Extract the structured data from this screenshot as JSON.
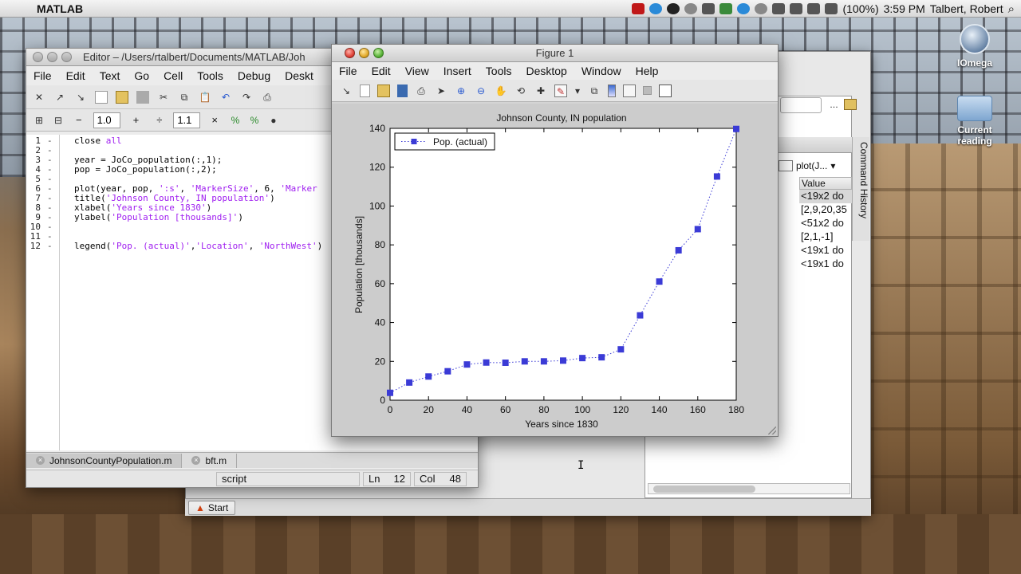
{
  "menubar": {
    "app": "MATLAB",
    "battery": "(100%)",
    "clock": "3:59 PM",
    "user": "Talbert, Robert"
  },
  "desktop": {
    "icons": [
      {
        "label": "IOmega"
      },
      {
        "label": "Current reading"
      }
    ]
  },
  "editor": {
    "title": "Editor – /Users/rtalbert/Documents/MATLAB/Joh",
    "menus": [
      "File",
      "Edit",
      "Text",
      "Go",
      "Cell",
      "Tools",
      "Debug",
      "Deskt"
    ],
    "cell_value_1": "1.0",
    "cell_value_2": "1.1",
    "cell_ops": [
      "−",
      "+",
      "÷",
      "×"
    ],
    "code_lines": [
      {
        "num": "1",
        "parts": [
          {
            "t": "close ",
            "c": "plain"
          },
          {
            "t": "all",
            "c": "str"
          }
        ]
      },
      {
        "num": "2",
        "parts": []
      },
      {
        "num": "3",
        "parts": [
          {
            "t": "year = JoCo_population(:,1);",
            "c": "plain"
          }
        ]
      },
      {
        "num": "4",
        "parts": [
          {
            "t": "pop = JoCo_population(:,2);",
            "c": "plain"
          }
        ]
      },
      {
        "num": "5",
        "parts": []
      },
      {
        "num": "6",
        "parts": [
          {
            "t": "plot(year, pop, ",
            "c": "plain"
          },
          {
            "t": "':s'",
            "c": "str"
          },
          {
            "t": ", ",
            "c": "plain"
          },
          {
            "t": "'MarkerSize'",
            "c": "str"
          },
          {
            "t": ", 6, ",
            "c": "plain"
          },
          {
            "t": "'Marker",
            "c": "str"
          }
        ]
      },
      {
        "num": "7",
        "parts": [
          {
            "t": "title(",
            "c": "plain"
          },
          {
            "t": "'Johnson County, IN population'",
            "c": "str"
          },
          {
            "t": ")",
            "c": "plain"
          }
        ]
      },
      {
        "num": "8",
        "parts": [
          {
            "t": "xlabel(",
            "c": "plain"
          },
          {
            "t": "'Years since 1830'",
            "c": "str"
          },
          {
            "t": ")",
            "c": "plain"
          }
        ]
      },
      {
        "num": "9",
        "parts": [
          {
            "t": "ylabel(",
            "c": "plain"
          },
          {
            "t": "'Population [thousands]'",
            "c": "str"
          },
          {
            "t": ")",
            "c": "plain"
          }
        ]
      },
      {
        "num": "10",
        "parts": []
      },
      {
        "num": "11",
        "parts": []
      },
      {
        "num": "12",
        "parts": [
          {
            "t": "legend(",
            "c": "plain"
          },
          {
            "t": "'Pop. (actual)'",
            "c": "str"
          },
          {
            "t": ",",
            "c": "plain"
          },
          {
            "t": "'Location'",
            "c": "str"
          },
          {
            "t": ", ",
            "c": "plain"
          },
          {
            "t": "'NorthWest'",
            "c": "str"
          },
          {
            "t": ")",
            "c": "plain"
          }
        ]
      }
    ],
    "tabs": [
      {
        "label": "JohnsonCountyPopulation.m",
        "active": true
      },
      {
        "label": "bft.m",
        "active": false
      }
    ],
    "status": {
      "mode": "script",
      "ln_label": "Ln",
      "ln": "12",
      "col_label": "Col",
      "col": "48"
    }
  },
  "workspace": {
    "plot_selector": "plot(J...",
    "header_value": "Value",
    "values": [
      "<19x2 do",
      "[2,9,20,35",
      "<51x2 do",
      "[2,1,-1]",
      "<19x1 do",
      "<19x1 do"
    ],
    "command_history": "Command History"
  },
  "start": {
    "label": "Start"
  },
  "figure": {
    "title": "Figure 1",
    "menus": [
      "File",
      "Edit",
      "View",
      "Insert",
      "Tools",
      "Desktop",
      "Window",
      "Help"
    ]
  },
  "chart_data": {
    "type": "line",
    "title": "Johnson County, IN population",
    "xlabel": "Years since 1830",
    "ylabel": "Population [thousands]",
    "xlim": [
      0,
      180
    ],
    "ylim": [
      0,
      140
    ],
    "xticks": [
      0,
      20,
      40,
      60,
      80,
      100,
      120,
      140,
      160,
      180
    ],
    "yticks": [
      0,
      20,
      40,
      60,
      80,
      100,
      120,
      140
    ],
    "legend_position": "top-left",
    "grid": false,
    "series": [
      {
        "name": "Pop. (actual)",
        "color": "#3b3bd6",
        "marker": "square",
        "line_style": "dotted",
        "x": [
          0,
          10,
          20,
          30,
          40,
          50,
          60,
          70,
          80,
          90,
          100,
          110,
          120,
          130,
          140,
          150,
          160,
          170,
          180
        ],
        "y": [
          3.8,
          9.1,
          12.2,
          14.9,
          18.4,
          19.4,
          19.3,
          20.0,
          20.0,
          20.4,
          21.7,
          22.1,
          26.2,
          43.7,
          61.1,
          77.2,
          88.1,
          115.2,
          139.7
        ]
      }
    ]
  }
}
